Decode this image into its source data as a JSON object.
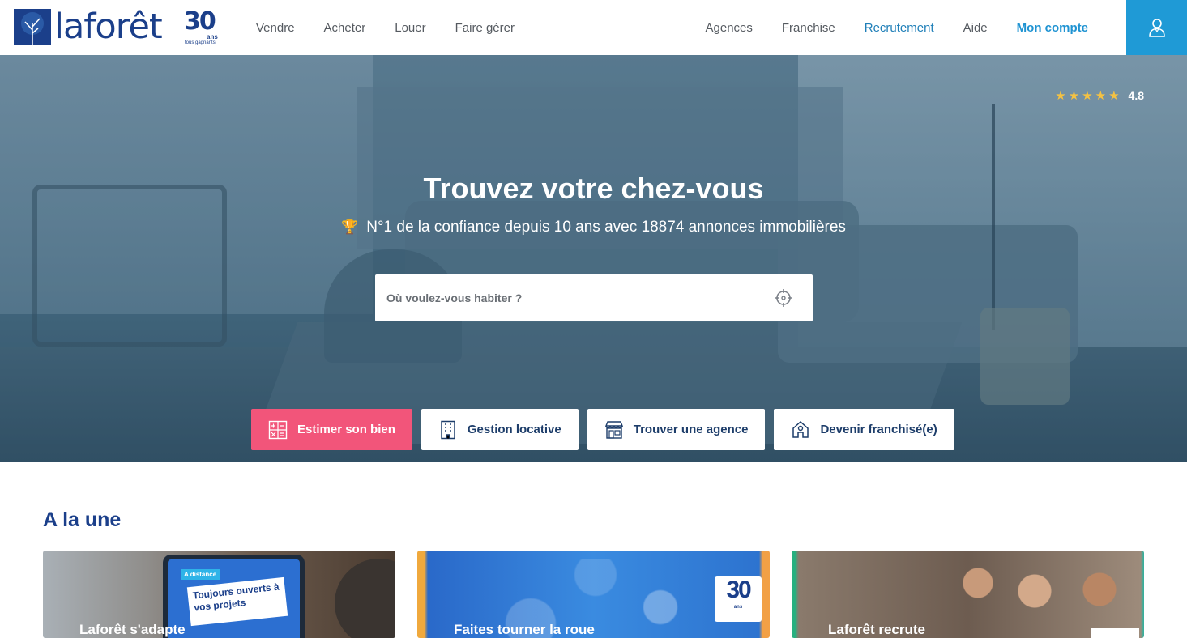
{
  "header": {
    "logo_text": "laforêt",
    "logo_badge": "30",
    "logo_ans": "ans",
    "logo_tagline": "tous gagnants",
    "nav_left": [
      "Vendre",
      "Acheter",
      "Louer",
      "Faire gérer"
    ],
    "nav_right": [
      {
        "label": "Agences",
        "style": "normal"
      },
      {
        "label": "Franchise",
        "style": "normal"
      },
      {
        "label": "Recrutement",
        "style": "accent"
      },
      {
        "label": "Aide",
        "style": "normal"
      },
      {
        "label": "Mon compte",
        "style": "strong"
      }
    ],
    "account_icon": "user-icon"
  },
  "hero": {
    "rating": {
      "stars": 5,
      "value": "4.8"
    },
    "title": "Trouvez votre chez-vous",
    "subtitle": "N°1 de la confiance depuis 10 ans avec 18874 annonces immobilières",
    "search": {
      "placeholder": "Où voulez-vous habiter ?",
      "value": ""
    },
    "actions": [
      {
        "label": "Estimer son bien",
        "icon": "calculator-icon",
        "primary": true
      },
      {
        "label": "Gestion locative",
        "icon": "building-icon",
        "primary": false
      },
      {
        "label": "Trouver une agence",
        "icon": "storefront-icon",
        "primary": false
      },
      {
        "label": "Devenir franchisé(e)",
        "icon": "house-pin-icon",
        "primary": false
      }
    ]
  },
  "featured": {
    "title": "A la une",
    "cards": [
      {
        "label": "Laforêt s'adapte",
        "tablet_tag": "A distance",
        "tablet_text": "Toujours ouverts à vos projets"
      },
      {
        "label": "Faites tourner la roue",
        "badge": "30",
        "badge_sub": "ans"
      },
      {
        "label": "Laforêt recrute"
      }
    ]
  },
  "colors": {
    "brand": "#1b3f8a",
    "accent": "#1f9ad6",
    "primary_button": "#f2557a",
    "star": "#f5c242"
  }
}
